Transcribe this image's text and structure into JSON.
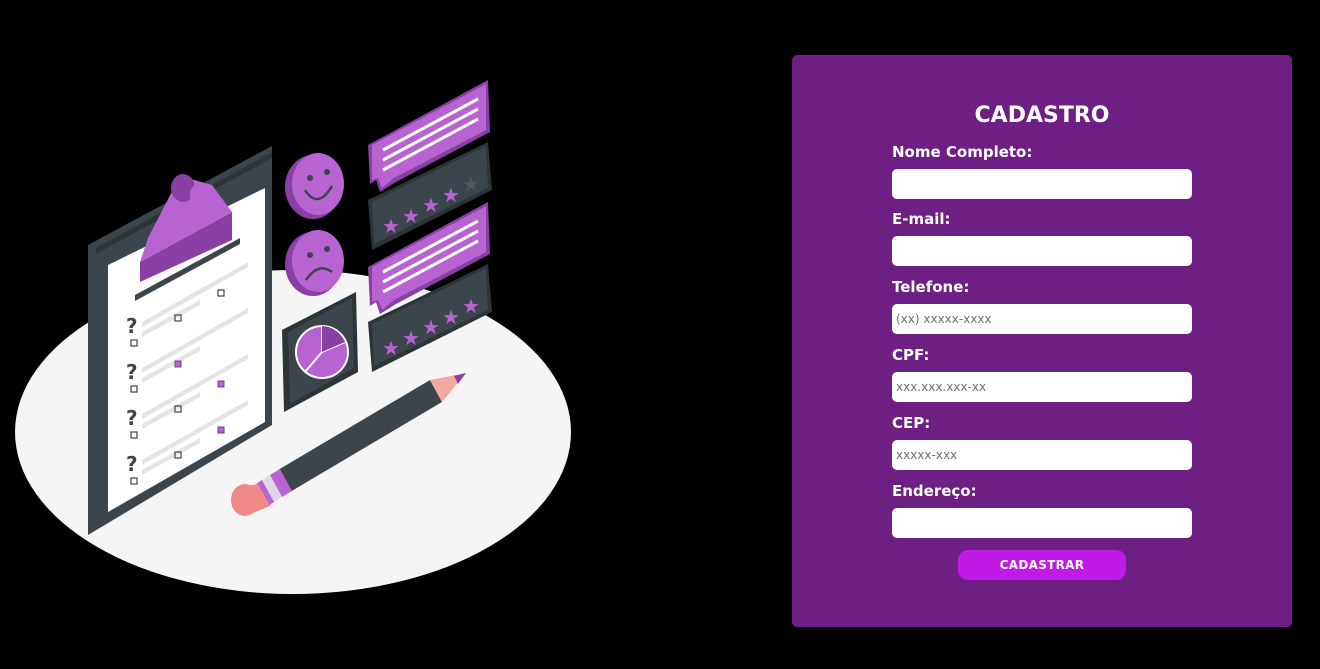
{
  "form": {
    "title": "CADASTRO",
    "fields": [
      {
        "label": "Nome Completo:",
        "value": "",
        "placeholder": ""
      },
      {
        "label": "E-mail:",
        "value": "",
        "placeholder": ""
      },
      {
        "label": "Telefone:",
        "value": "",
        "placeholder": "(xx) xxxxx-xxxx"
      },
      {
        "label": "CPF:",
        "value": "",
        "placeholder": "xxx.xxx.xxx-xx"
      },
      {
        "label": "CEP:",
        "value": "",
        "placeholder": "xxxxx-xxx"
      },
      {
        "label": "Endereço:",
        "value": "",
        "placeholder": ""
      }
    ],
    "submit_label": "CADASTRAR"
  },
  "illustration": {
    "name": "survey-clipboard-illustration"
  },
  "colors": {
    "background": "#000000",
    "card": "#6e1f83",
    "accent": "#c21ae6",
    "illustration_purple": "#b764d2",
    "illustration_dark": "#3b454b"
  }
}
